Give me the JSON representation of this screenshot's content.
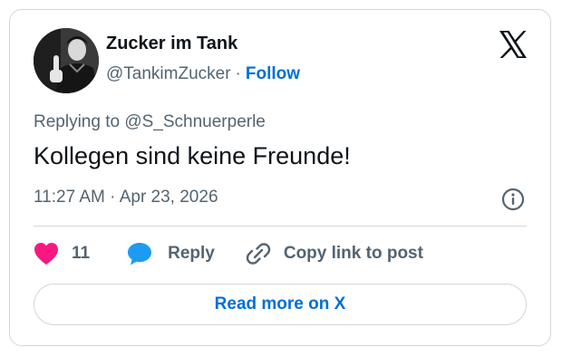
{
  "author": {
    "display_name": "Zucker im Tank",
    "handle": "@TankimZucker",
    "separator": "·",
    "follow_label": "Follow"
  },
  "tweet": {
    "replying_to": "Replying to @S_Schnuerperle",
    "text": "Kollegen sind keine Freunde!",
    "timestamp": "11:27 AM · Apr 23, 2026"
  },
  "actions": {
    "like_count": "11",
    "reply_label": "Reply",
    "copy_link_label": "Copy link to post"
  },
  "footer": {
    "read_more_label": "Read more on X"
  },
  "icons": {
    "brand": "x-logo-icon",
    "info": "info-icon",
    "like": "heart-icon",
    "reply": "speech-bubble-icon",
    "copy": "link-icon"
  },
  "colors": {
    "like": "#f91880",
    "reply": "#1d9bf0",
    "link": "#006fd6",
    "secondary_text": "#536471",
    "primary_text": "#0f1419",
    "border": "#cfd9de"
  }
}
